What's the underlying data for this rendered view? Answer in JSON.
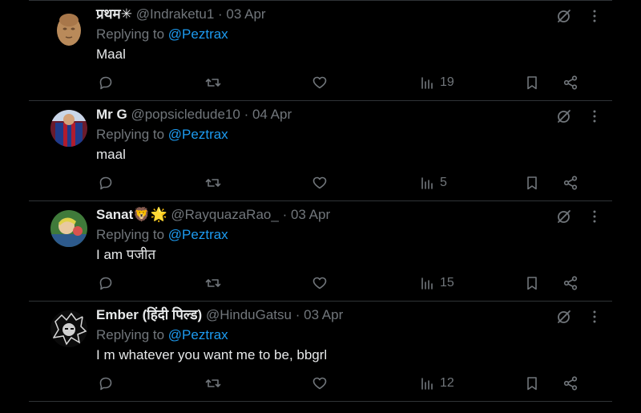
{
  "tweets": [
    {
      "name": "प्रथम✳",
      "handle": "@Indraketu1",
      "separator": "·",
      "date": "03 Apr",
      "replying_prefix": "Replying to",
      "replying_to": "@Peztrax",
      "text": "Maal",
      "views": "19",
      "avatar_icon": "stone-sculpture-avatar"
    },
    {
      "name": "Mr G",
      "handle": "@popsicledude10",
      "separator": "·",
      "date": "04 Apr",
      "replying_prefix": "Replying to",
      "replying_to": "@Peztrax",
      "text": "maal",
      "views": "5",
      "avatar_icon": "jersey-avatar"
    },
    {
      "name": "Sanat🦁🌟",
      "handle": "@RayquazaRao_",
      "separator": "·",
      "date": "03 Apr",
      "replying_prefix": "Replying to",
      "replying_to": "@Peztrax",
      "text": "I am पजीत",
      "views": "15",
      "avatar_icon": "cartoon-avatar"
    },
    {
      "name": "Ember (हिंदी पिल्ड)",
      "handle": "@HinduGatsu",
      "separator": "·",
      "date": "03 Apr",
      "replying_prefix": "Replying to",
      "replying_to": "@Peztrax",
      "text": "I m whatever you want me to be, bbgrl",
      "views": "12",
      "avatar_icon": "manga-avatar"
    }
  ],
  "colors": {
    "background": "#000000",
    "text": "#e7e9ea",
    "muted": "#71767b",
    "link": "#1d9bf0",
    "divider": "#2f3336"
  }
}
